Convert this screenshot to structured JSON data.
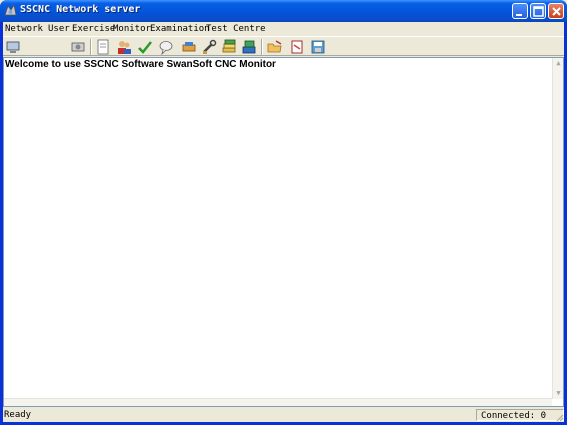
{
  "window": {
    "title": "SSCNC Network server"
  },
  "menu": {
    "items": [
      "Network",
      "User",
      "Exercise",
      "Monitor",
      "Examination",
      "Test Centre"
    ]
  },
  "toolbar": {
    "icons": [
      "connect-icon",
      "disconnect-icon",
      "document-icon",
      "users-icon",
      "check-icon",
      "chat-icon",
      "tools-icon",
      "books-icon",
      "books-blue-icon",
      "open-folder-icon",
      "notebook-icon",
      "disk-icon"
    ]
  },
  "content": {
    "welcome": "Welcome to use SSCNC Software SwanSoft CNC Monitor"
  },
  "status": {
    "left": "Ready",
    "right": "Connected: 0"
  },
  "colors": {
    "titlebar": "#0054e3",
    "menubar": "#ece9d8",
    "close_button": "#c4401f"
  }
}
